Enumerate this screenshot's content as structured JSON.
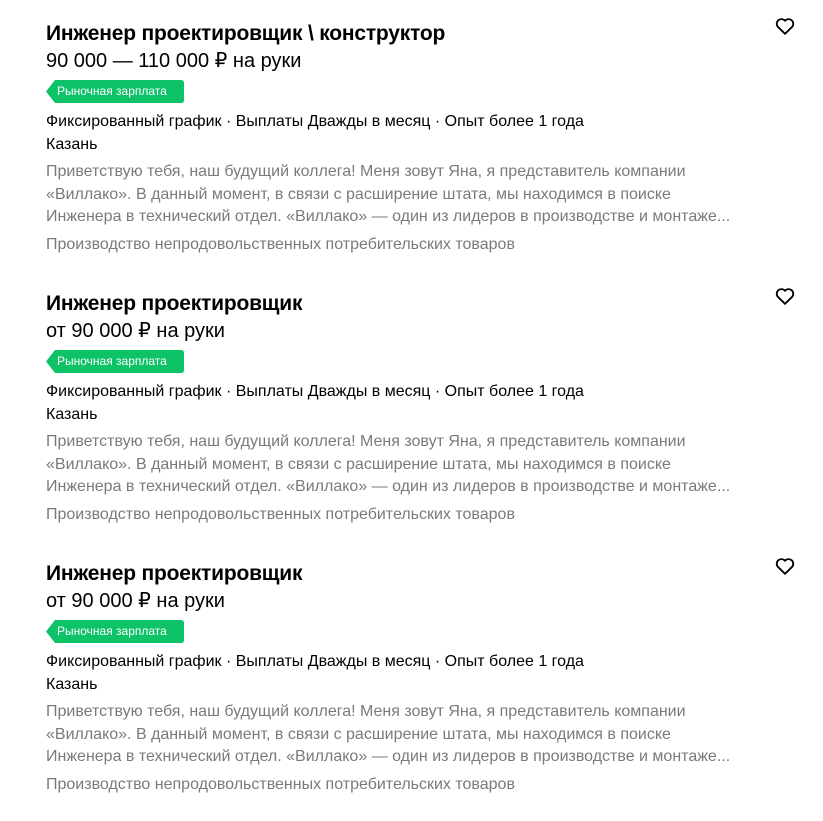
{
  "vacancies": [
    {
      "title": "Инженер проектировщик \\ конструктор",
      "salary": "90 000 — 110 000 ₽ на руки",
      "badge": "Рыночная зарплата",
      "meta": "Фиксированный график · Выплаты Дважды в месяц · Опыт более 1 года",
      "city": "Казань",
      "description_lines": [
        "Приветствую тебя, наш будущий коллега! Меня зовут Яна, я представитель компании",
        "«Виллако». В данный момент, в связи с расширение штата, мы находимся в поиске",
        "Инженера в технический отдел. «Виллако» — один из лидеров в производстве и монтаже..."
      ],
      "industry": "Производство непродовольственных потребительских товаров",
      "favorite_icon": "heart-outline-icon"
    },
    {
      "title": "Инженер проектировщик",
      "salary": "от 90 000 ₽ на руки",
      "badge": "Рыночная зарплата",
      "meta": "Фиксированный график · Выплаты Дважды в месяц · Опыт более 1 года",
      "city": "Казань",
      "description_lines": [
        "Приветствую тебя, наш будущий коллега! Меня зовут Яна, я представитель компании",
        "«Виллако». В данный момент, в связи с расширение штата, мы находимся в поиске",
        "Инженера в технический отдел. «Виллако» — один из лидеров в производстве и монтаже..."
      ],
      "industry": "Производство непродовольственных потребительских товаров",
      "favorite_icon": "heart-outline-icon"
    },
    {
      "title": "Инженер проектировщик",
      "salary": "от 90 000 ₽ на руки",
      "badge": "Рыночная зарплата",
      "meta": "Фиксированный график · Выплаты Дважды в месяц · Опыт более 1 года",
      "city": "Казань",
      "description_lines": [
        "Приветствую тебя, наш будущий коллега! Меня зовут Яна, я представитель компании",
        "«Виллако». В данный момент, в связи с расширение штата, мы находимся в поиске",
        "Инженера в технический отдел. «Виллако» — один из лидеров в производстве и монтаже..."
      ],
      "industry": "Производство непродовольственных потребительских товаров",
      "favorite_icon": "heart-outline-icon"
    }
  ],
  "colors": {
    "badge_bg": "#0dc267",
    "muted_text": "#7a7a7a",
    "primary_text": "#000000"
  }
}
